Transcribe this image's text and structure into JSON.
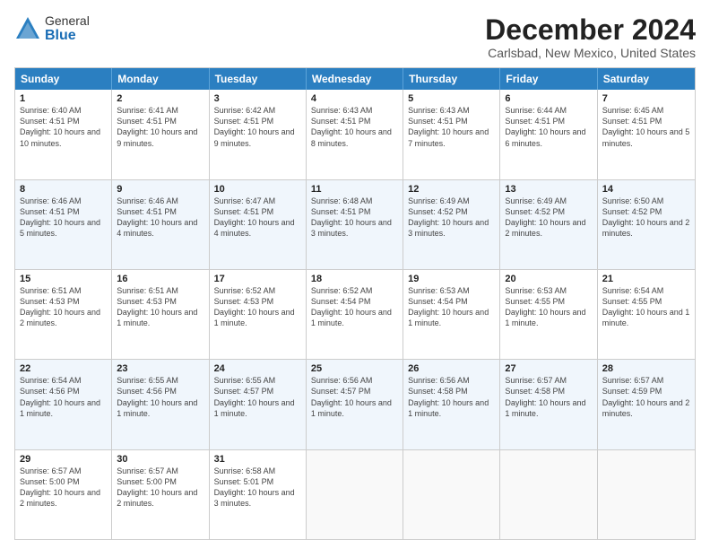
{
  "logo": {
    "general": "General",
    "blue": "Blue"
  },
  "title": {
    "month_year": "December 2024",
    "location": "Carlsbad, New Mexico, United States"
  },
  "header_days": [
    "Sunday",
    "Monday",
    "Tuesday",
    "Wednesday",
    "Thursday",
    "Friday",
    "Saturday"
  ],
  "weeks": [
    [
      {
        "day": "1",
        "sunrise": "Sunrise: 6:40 AM",
        "sunset": "Sunset: 4:51 PM",
        "daylight": "Daylight: 10 hours and 10 minutes."
      },
      {
        "day": "2",
        "sunrise": "Sunrise: 6:41 AM",
        "sunset": "Sunset: 4:51 PM",
        "daylight": "Daylight: 10 hours and 9 minutes."
      },
      {
        "day": "3",
        "sunrise": "Sunrise: 6:42 AM",
        "sunset": "Sunset: 4:51 PM",
        "daylight": "Daylight: 10 hours and 9 minutes."
      },
      {
        "day": "4",
        "sunrise": "Sunrise: 6:43 AM",
        "sunset": "Sunset: 4:51 PM",
        "daylight": "Daylight: 10 hours and 8 minutes."
      },
      {
        "day": "5",
        "sunrise": "Sunrise: 6:43 AM",
        "sunset": "Sunset: 4:51 PM",
        "daylight": "Daylight: 10 hours and 7 minutes."
      },
      {
        "day": "6",
        "sunrise": "Sunrise: 6:44 AM",
        "sunset": "Sunset: 4:51 PM",
        "daylight": "Daylight: 10 hours and 6 minutes."
      },
      {
        "day": "7",
        "sunrise": "Sunrise: 6:45 AM",
        "sunset": "Sunset: 4:51 PM",
        "daylight": "Daylight: 10 hours and 5 minutes."
      }
    ],
    [
      {
        "day": "8",
        "sunrise": "Sunrise: 6:46 AM",
        "sunset": "Sunset: 4:51 PM",
        "daylight": "Daylight: 10 hours and 5 minutes."
      },
      {
        "day": "9",
        "sunrise": "Sunrise: 6:46 AM",
        "sunset": "Sunset: 4:51 PM",
        "daylight": "Daylight: 10 hours and 4 minutes."
      },
      {
        "day": "10",
        "sunrise": "Sunrise: 6:47 AM",
        "sunset": "Sunset: 4:51 PM",
        "daylight": "Daylight: 10 hours and 4 minutes."
      },
      {
        "day": "11",
        "sunrise": "Sunrise: 6:48 AM",
        "sunset": "Sunset: 4:51 PM",
        "daylight": "Daylight: 10 hours and 3 minutes."
      },
      {
        "day": "12",
        "sunrise": "Sunrise: 6:49 AM",
        "sunset": "Sunset: 4:52 PM",
        "daylight": "Daylight: 10 hours and 3 minutes."
      },
      {
        "day": "13",
        "sunrise": "Sunrise: 6:49 AM",
        "sunset": "Sunset: 4:52 PM",
        "daylight": "Daylight: 10 hours and 2 minutes."
      },
      {
        "day": "14",
        "sunrise": "Sunrise: 6:50 AM",
        "sunset": "Sunset: 4:52 PM",
        "daylight": "Daylight: 10 hours and 2 minutes."
      }
    ],
    [
      {
        "day": "15",
        "sunrise": "Sunrise: 6:51 AM",
        "sunset": "Sunset: 4:53 PM",
        "daylight": "Daylight: 10 hours and 2 minutes."
      },
      {
        "day": "16",
        "sunrise": "Sunrise: 6:51 AM",
        "sunset": "Sunset: 4:53 PM",
        "daylight": "Daylight: 10 hours and 1 minute."
      },
      {
        "day": "17",
        "sunrise": "Sunrise: 6:52 AM",
        "sunset": "Sunset: 4:53 PM",
        "daylight": "Daylight: 10 hours and 1 minute."
      },
      {
        "day": "18",
        "sunrise": "Sunrise: 6:52 AM",
        "sunset": "Sunset: 4:54 PM",
        "daylight": "Daylight: 10 hours and 1 minute."
      },
      {
        "day": "19",
        "sunrise": "Sunrise: 6:53 AM",
        "sunset": "Sunset: 4:54 PM",
        "daylight": "Daylight: 10 hours and 1 minute."
      },
      {
        "day": "20",
        "sunrise": "Sunrise: 6:53 AM",
        "sunset": "Sunset: 4:55 PM",
        "daylight": "Daylight: 10 hours and 1 minute."
      },
      {
        "day": "21",
        "sunrise": "Sunrise: 6:54 AM",
        "sunset": "Sunset: 4:55 PM",
        "daylight": "Daylight: 10 hours and 1 minute."
      }
    ],
    [
      {
        "day": "22",
        "sunrise": "Sunrise: 6:54 AM",
        "sunset": "Sunset: 4:56 PM",
        "daylight": "Daylight: 10 hours and 1 minute."
      },
      {
        "day": "23",
        "sunrise": "Sunrise: 6:55 AM",
        "sunset": "Sunset: 4:56 PM",
        "daylight": "Daylight: 10 hours and 1 minute."
      },
      {
        "day": "24",
        "sunrise": "Sunrise: 6:55 AM",
        "sunset": "Sunset: 4:57 PM",
        "daylight": "Daylight: 10 hours and 1 minute."
      },
      {
        "day": "25",
        "sunrise": "Sunrise: 6:56 AM",
        "sunset": "Sunset: 4:57 PM",
        "daylight": "Daylight: 10 hours and 1 minute."
      },
      {
        "day": "26",
        "sunrise": "Sunrise: 6:56 AM",
        "sunset": "Sunset: 4:58 PM",
        "daylight": "Daylight: 10 hours and 1 minute."
      },
      {
        "day": "27",
        "sunrise": "Sunrise: 6:57 AM",
        "sunset": "Sunset: 4:58 PM",
        "daylight": "Daylight: 10 hours and 1 minute."
      },
      {
        "day": "28",
        "sunrise": "Sunrise: 6:57 AM",
        "sunset": "Sunset: 4:59 PM",
        "daylight": "Daylight: 10 hours and 2 minutes."
      }
    ],
    [
      {
        "day": "29",
        "sunrise": "Sunrise: 6:57 AM",
        "sunset": "Sunset: 5:00 PM",
        "daylight": "Daylight: 10 hours and 2 minutes."
      },
      {
        "day": "30",
        "sunrise": "Sunrise: 6:57 AM",
        "sunset": "Sunset: 5:00 PM",
        "daylight": "Daylight: 10 hours and 2 minutes."
      },
      {
        "day": "31",
        "sunrise": "Sunrise: 6:58 AM",
        "sunset": "Sunset: 5:01 PM",
        "daylight": "Daylight: 10 hours and 3 minutes."
      },
      null,
      null,
      null,
      null
    ]
  ]
}
